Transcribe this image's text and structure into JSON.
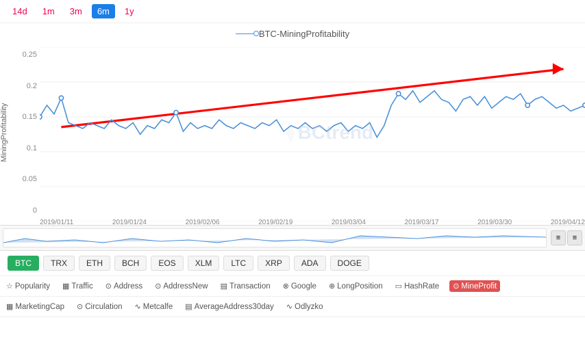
{
  "timeButtons": [
    {
      "label": "14d",
      "active": false
    },
    {
      "label": "1m",
      "active": false
    },
    {
      "label": "3m",
      "active": false
    },
    {
      "label": "6m",
      "active": true
    },
    {
      "label": "1y",
      "active": false
    }
  ],
  "chartTitle": "BTC-MiningProfitability",
  "yAxis": {
    "labels": [
      "0.25",
      "0.2",
      "0.15",
      "0.1",
      "0.05",
      "0"
    ]
  },
  "xAxis": {
    "labels": [
      "2019/01/11",
      "2019/01/24",
      "2019/02/06",
      "2019/02/19",
      "2019/03/04",
      "2019/03/17",
      "2019/03/30",
      "2019/04/12"
    ]
  },
  "yAxisLabel": "MiningProfitability",
  "coins": [
    {
      "label": "BTC",
      "active": true
    },
    {
      "label": "TRX",
      "active": false
    },
    {
      "label": "ETH",
      "active": false
    },
    {
      "label": "BCH",
      "active": false
    },
    {
      "label": "EOS",
      "active": false
    },
    {
      "label": "XLM",
      "active": false
    },
    {
      "label": "LTC",
      "active": false
    },
    {
      "label": "XRP",
      "active": false
    },
    {
      "label": "ADA",
      "active": false
    },
    {
      "label": "DOGE",
      "active": false
    }
  ],
  "metrics1": [
    {
      "label": "Popularity",
      "icon": "☆"
    },
    {
      "label": "Traffic",
      "icon": "▦"
    },
    {
      "label": "Address",
      "icon": "⊙"
    },
    {
      "label": "AddressNew",
      "icon": "⊙"
    },
    {
      "label": "Transaction",
      "icon": "▤"
    },
    {
      "label": "Google",
      "icon": "⊗"
    },
    {
      "label": "LongPosition",
      "icon": "⊕"
    },
    {
      "label": "HashRate",
      "icon": "▭"
    },
    {
      "label": "MineProfit",
      "icon": "⊙",
      "active": true
    }
  ],
  "metrics2": [
    {
      "label": "MarketingCap",
      "icon": "▦"
    },
    {
      "label": "Circulation",
      "icon": "⊙"
    },
    {
      "label": "Metcalfe",
      "icon": "∿"
    },
    {
      "label": "AverageAddress30day",
      "icon": "▤"
    },
    {
      "label": "Odlyzko",
      "icon": "∿"
    }
  ],
  "watermark": "BCtrend"
}
